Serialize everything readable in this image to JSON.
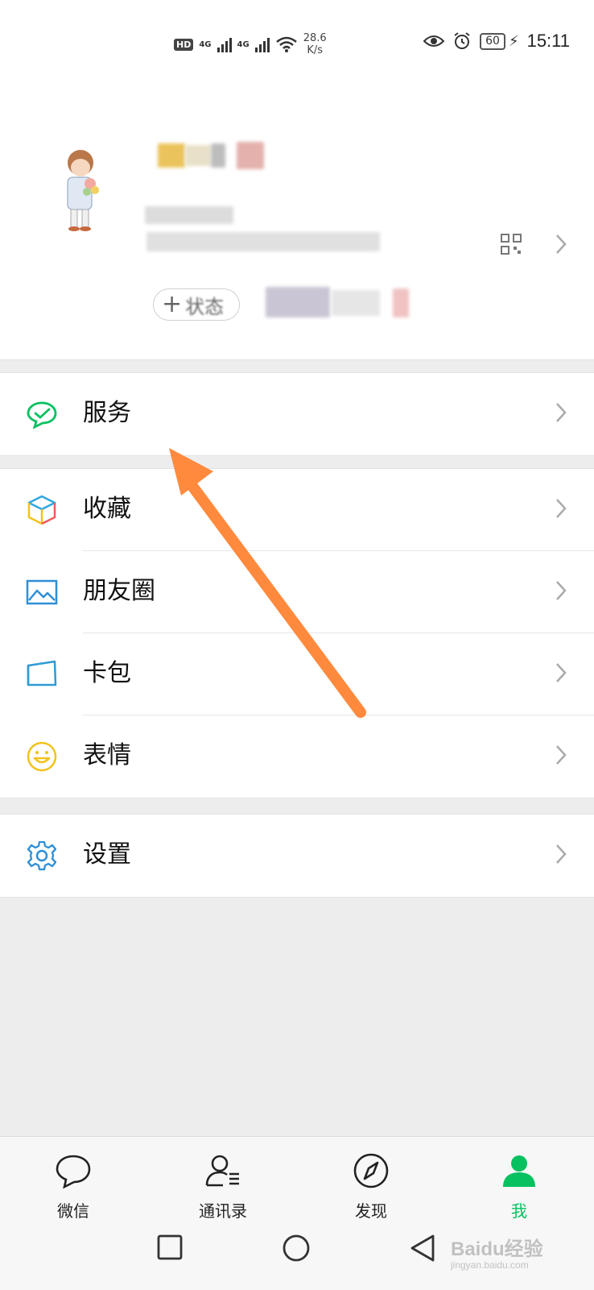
{
  "status_bar": {
    "hd": "HD",
    "net_type_1": "4G",
    "net_type_2": "4G",
    "speed_value": "28.6",
    "speed_unit": "K/s",
    "battery": "60",
    "time": "15:11"
  },
  "profile": {
    "status_button_label": "状态"
  },
  "menu": {
    "services": "服务",
    "favorites": "收藏",
    "moments": "朋友圈",
    "cards": "卡包",
    "stickers": "表情",
    "settings": "设置"
  },
  "tabs": {
    "chats": "微信",
    "contacts": "通讯录",
    "discover": "发现",
    "me": "我"
  },
  "watermark": {
    "brand": "Baidu经验",
    "url": "jingyan.baidu.com"
  },
  "colors": {
    "accent_green": "#07c160",
    "annotation_orange": "#ff8a3d"
  }
}
